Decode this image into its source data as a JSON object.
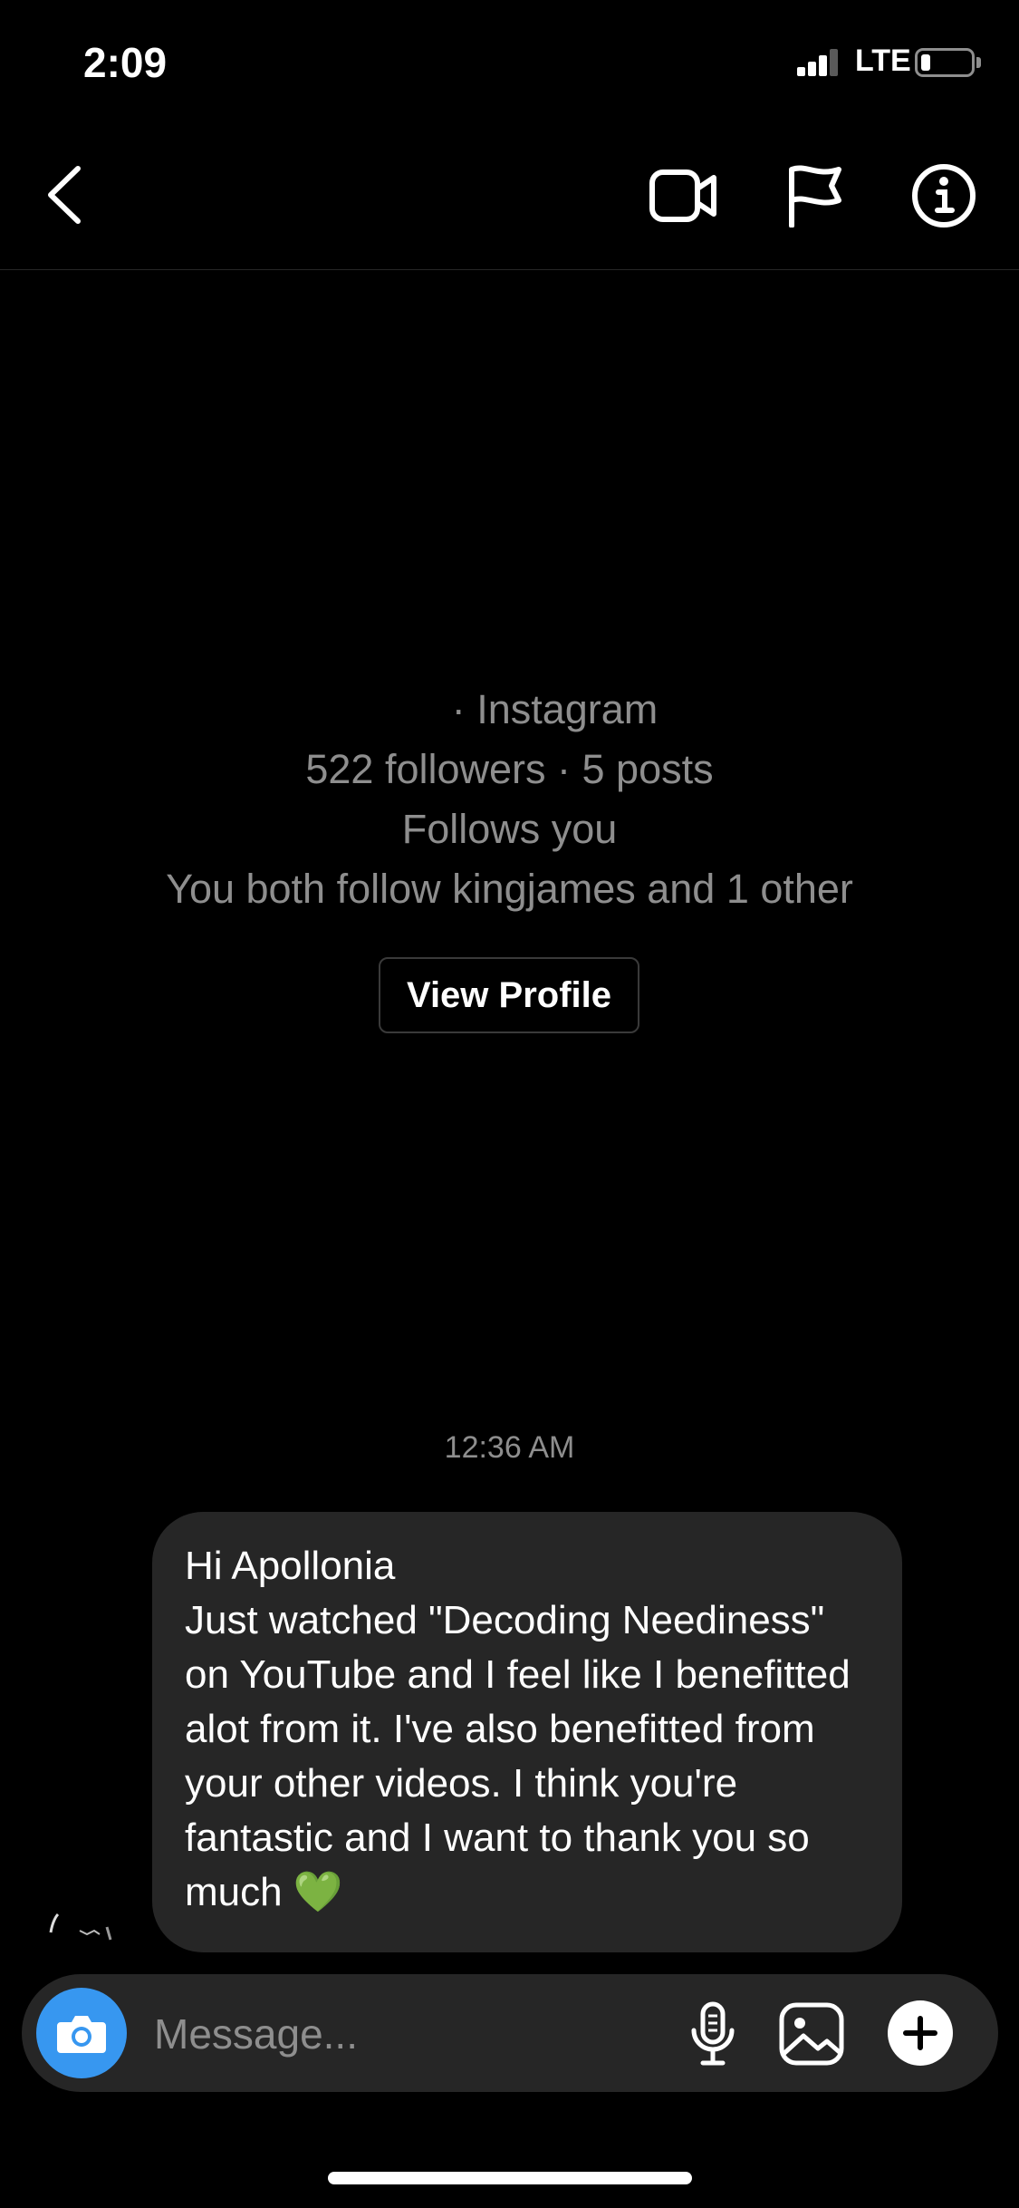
{
  "status_bar": {
    "time": "2:09",
    "network": "LTE",
    "battery_level": 0.2
  },
  "nav": {
    "back_icon": "chevron-left-icon",
    "video_icon": "video-camera-icon",
    "flag_icon": "flag-icon",
    "info_icon": "info-icon"
  },
  "profile": {
    "platform": "· Instagram",
    "stats": "522 followers · 5 posts",
    "follow_status": "Follows you",
    "mutuals": "You both follow kingjames and 1 other",
    "view_profile_label": "View Profile"
  },
  "thread": {
    "timestamp": "12:36 AM",
    "messages": [
      {
        "greeting": "Hi Apollonia",
        "body": "Just watched \"Decoding Neediness\" on YouTube and I feel like I benefitted alot from it. I've also benefitted from your other videos. I think you're fantastic and I want to thank you so much",
        "emoji": "💚"
      }
    ]
  },
  "composer": {
    "placeholder": "Message...",
    "camera_icon": "camera-icon",
    "mic_icon": "microphone-icon",
    "gallery_icon": "image-icon",
    "plus_icon": "plus-icon"
  },
  "colors": {
    "background": "#000000",
    "bubble": "#262626",
    "secondary_text": "#8e8e8e",
    "accent": "#3797f0"
  }
}
